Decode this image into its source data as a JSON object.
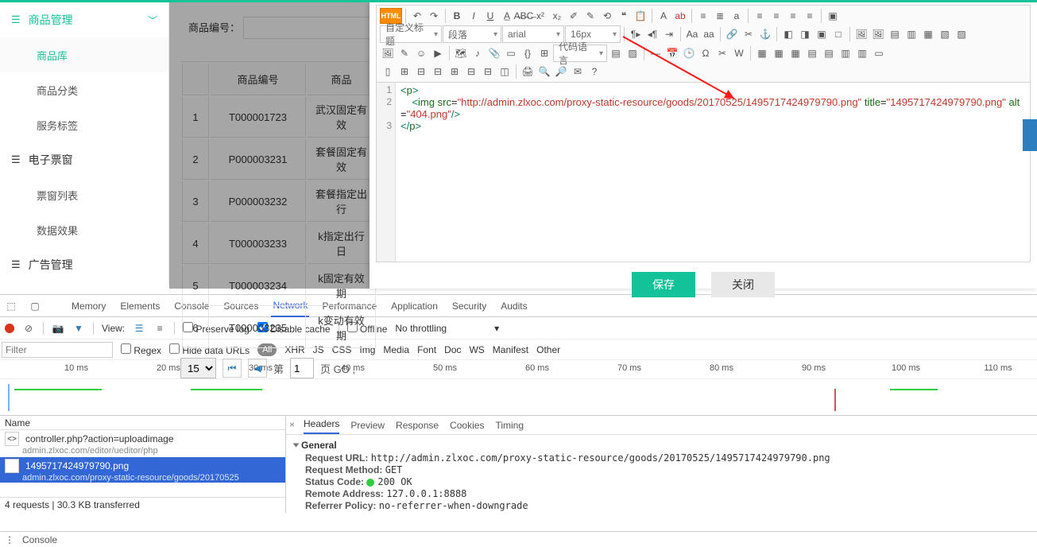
{
  "sidebar": {
    "groups": [
      {
        "icon": "list",
        "label": "商品管理",
        "expanded": true,
        "active": true,
        "items": [
          {
            "label": "商品库",
            "active": true
          },
          {
            "label": "商品分类",
            "active": false
          },
          {
            "label": "服务标签",
            "active": false
          }
        ]
      },
      {
        "icon": "list",
        "label": "电子票窗",
        "expanded": true,
        "active": false,
        "items": [
          {
            "label": "票窗列表",
            "active": false
          },
          {
            "label": "数据效果",
            "active": false
          }
        ]
      },
      {
        "icon": "list",
        "label": "广告管理",
        "expanded": false,
        "active": false,
        "items": []
      }
    ]
  },
  "page": {
    "code_label": "商品编号：",
    "table": {
      "headers": [
        "",
        "商品编号",
        "商品"
      ],
      "rows": [
        [
          "1",
          "T000001723",
          "武汉固定有效"
        ],
        [
          "2",
          "P000003231",
          "套餐固定有效"
        ],
        [
          "3",
          "P000003232",
          "套餐指定出行"
        ],
        [
          "4",
          "T000003233",
          "k指定出行日"
        ],
        [
          "5",
          "T000003234",
          "k固定有效期"
        ],
        [
          "6",
          "T000003235",
          "k变动有效期"
        ]
      ]
    },
    "pager": {
      "size": "15",
      "page_lbl": "第",
      "page_val": "1",
      "suffix": "页 GO ,"
    }
  },
  "editor": {
    "html_btn": "HTML",
    "style_sel": "自定义标题",
    "para_sel": "段落",
    "font_sel": "arial",
    "size_sel": "16px",
    "codelang": "代码语言",
    "code_lines": [
      "1",
      "2",
      "3"
    ],
    "code_html": "<span class='tk-ang'>&lt;</span><span class='tk-tag'>p</span><span class='tk-ang'>&gt;</span>\n    <span class='tk-ang'>&lt;</span><span class='tk-tag'>img</span> <span class='tk-attr'>src</span>=<span class='tk-str'>\"http://admin.zlxoc.com/proxy-static-resource/goods/20170525/1495717424979790.png\"</span> <span class='tk-attr'>title</span>=<span class='tk-str'>\"1495717424979790.png\"</span> <span class='tk-attr'>alt</span>=<span class='tk-str'>\"404.png\"</span><span class='tk-ang'>/&gt;</span>\n<span class='tk-ang'>&lt;/</span><span class='tk-tag'>p</span><span class='tk-ang'>&gt;</span>",
    "save": "保存",
    "close": "关闭"
  },
  "devtools": {
    "tabs": [
      "Memory",
      "Elements",
      "Console",
      "Sources",
      "Network",
      "Performance",
      "Application",
      "Security",
      "Audits"
    ],
    "active_tab": "Network",
    "row2": {
      "view": "View:",
      "preserve": "Preserve log",
      "disable": "Disable cache",
      "offline": "Offline",
      "throttle": "No throttling"
    },
    "row3": {
      "filter_ph": "Filter",
      "regex": "Regex",
      "hide": "Hide data URLs",
      "all": "All",
      "kinds": [
        "XHR",
        "JS",
        "CSS",
        "Img",
        "Media",
        "Font",
        "Doc",
        "WS",
        "Manifest",
        "Other"
      ]
    },
    "timeline": [
      "10 ms",
      "20 ms",
      "30 ms",
      "40 ms",
      "50 ms",
      "60 ms",
      "70 ms",
      "80 ms",
      "90 ms",
      "100 ms",
      "110 ms"
    ],
    "netlist": {
      "header": "Name",
      "rows": [
        {
          "name": "controller.php?action=uploadimage",
          "sub": "admin.zlxoc.com/editor/ueditor/php",
          "sel": false,
          "icon": "<>"
        },
        {
          "name": "1495717424979790.png",
          "sub": "admin.zlxoc.com/proxy-static-resource/goods/20170525",
          "sel": true,
          "icon": "▦"
        }
      ],
      "status": "4 requests  |  30.3 KB transferred"
    },
    "detail": {
      "tabs": [
        "Headers",
        "Preview",
        "Response",
        "Cookies",
        "Timing"
      ],
      "active": "Headers",
      "general": "General",
      "kv": [
        {
          "k": "Request URL:",
          "v": "http://admin.zlxoc.com/proxy-static-resource/goods/20170525/1495717424979790.png"
        },
        {
          "k": "Request Method:",
          "v": "GET"
        },
        {
          "k": "Status Code:",
          "v": "200 OK",
          "dot": true
        },
        {
          "k": "Remote Address:",
          "v": "127.0.0.1:8888"
        },
        {
          "k": "Referrer Policy:",
          "v": "no-referrer-when-downgrade"
        }
      ]
    },
    "drawer": "Console"
  }
}
